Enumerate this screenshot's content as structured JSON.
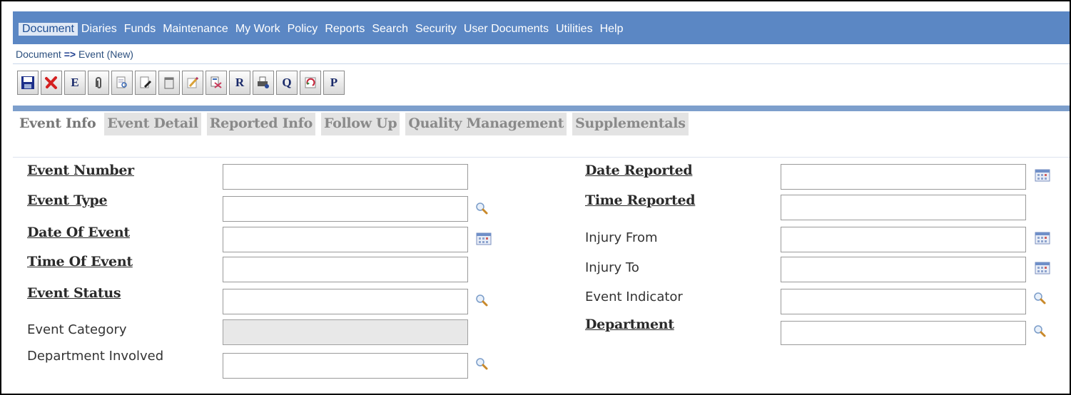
{
  "menu": [
    "Document",
    "Diaries",
    "Funds",
    "Maintenance",
    "My Work",
    "Policy",
    "Reports",
    "Search",
    "Security",
    "User Documents",
    "Utilities",
    "Help"
  ],
  "breadcrumb": {
    "parent": "Document",
    "arrow": "=>",
    "current": "Event (New)"
  },
  "toolbar_letters": {
    "e": "E",
    "r": "R",
    "q": "Q",
    "p": "P"
  },
  "tabs": [
    "Event Info",
    "Event Detail",
    "Reported Info",
    "Follow Up",
    "Quality Management",
    "Supplementals"
  ],
  "form": {
    "left": [
      {
        "label": "Event Number",
        "value": ""
      },
      {
        "label": "Event Type",
        "value": ""
      },
      {
        "label": "Date Of Event",
        "value": ""
      },
      {
        "label": "Time Of Event",
        "value": ""
      },
      {
        "label": "Event Status",
        "value": ""
      },
      {
        "label": "Event Category",
        "value": ""
      },
      {
        "label": "Department Involved",
        "value": ""
      }
    ],
    "right": [
      {
        "label": "Date Reported",
        "value": ""
      },
      {
        "label": "Time Reported",
        "value": ""
      },
      {
        "label": "Injury From",
        "value": ""
      },
      {
        "label": "Injury To",
        "value": ""
      },
      {
        "label": "Event Indicator",
        "value": ""
      },
      {
        "label": "Department",
        "value": ""
      }
    ]
  },
  "colors": {
    "menubar": "#5b87c4",
    "tabbar": "#7d9fcc"
  }
}
